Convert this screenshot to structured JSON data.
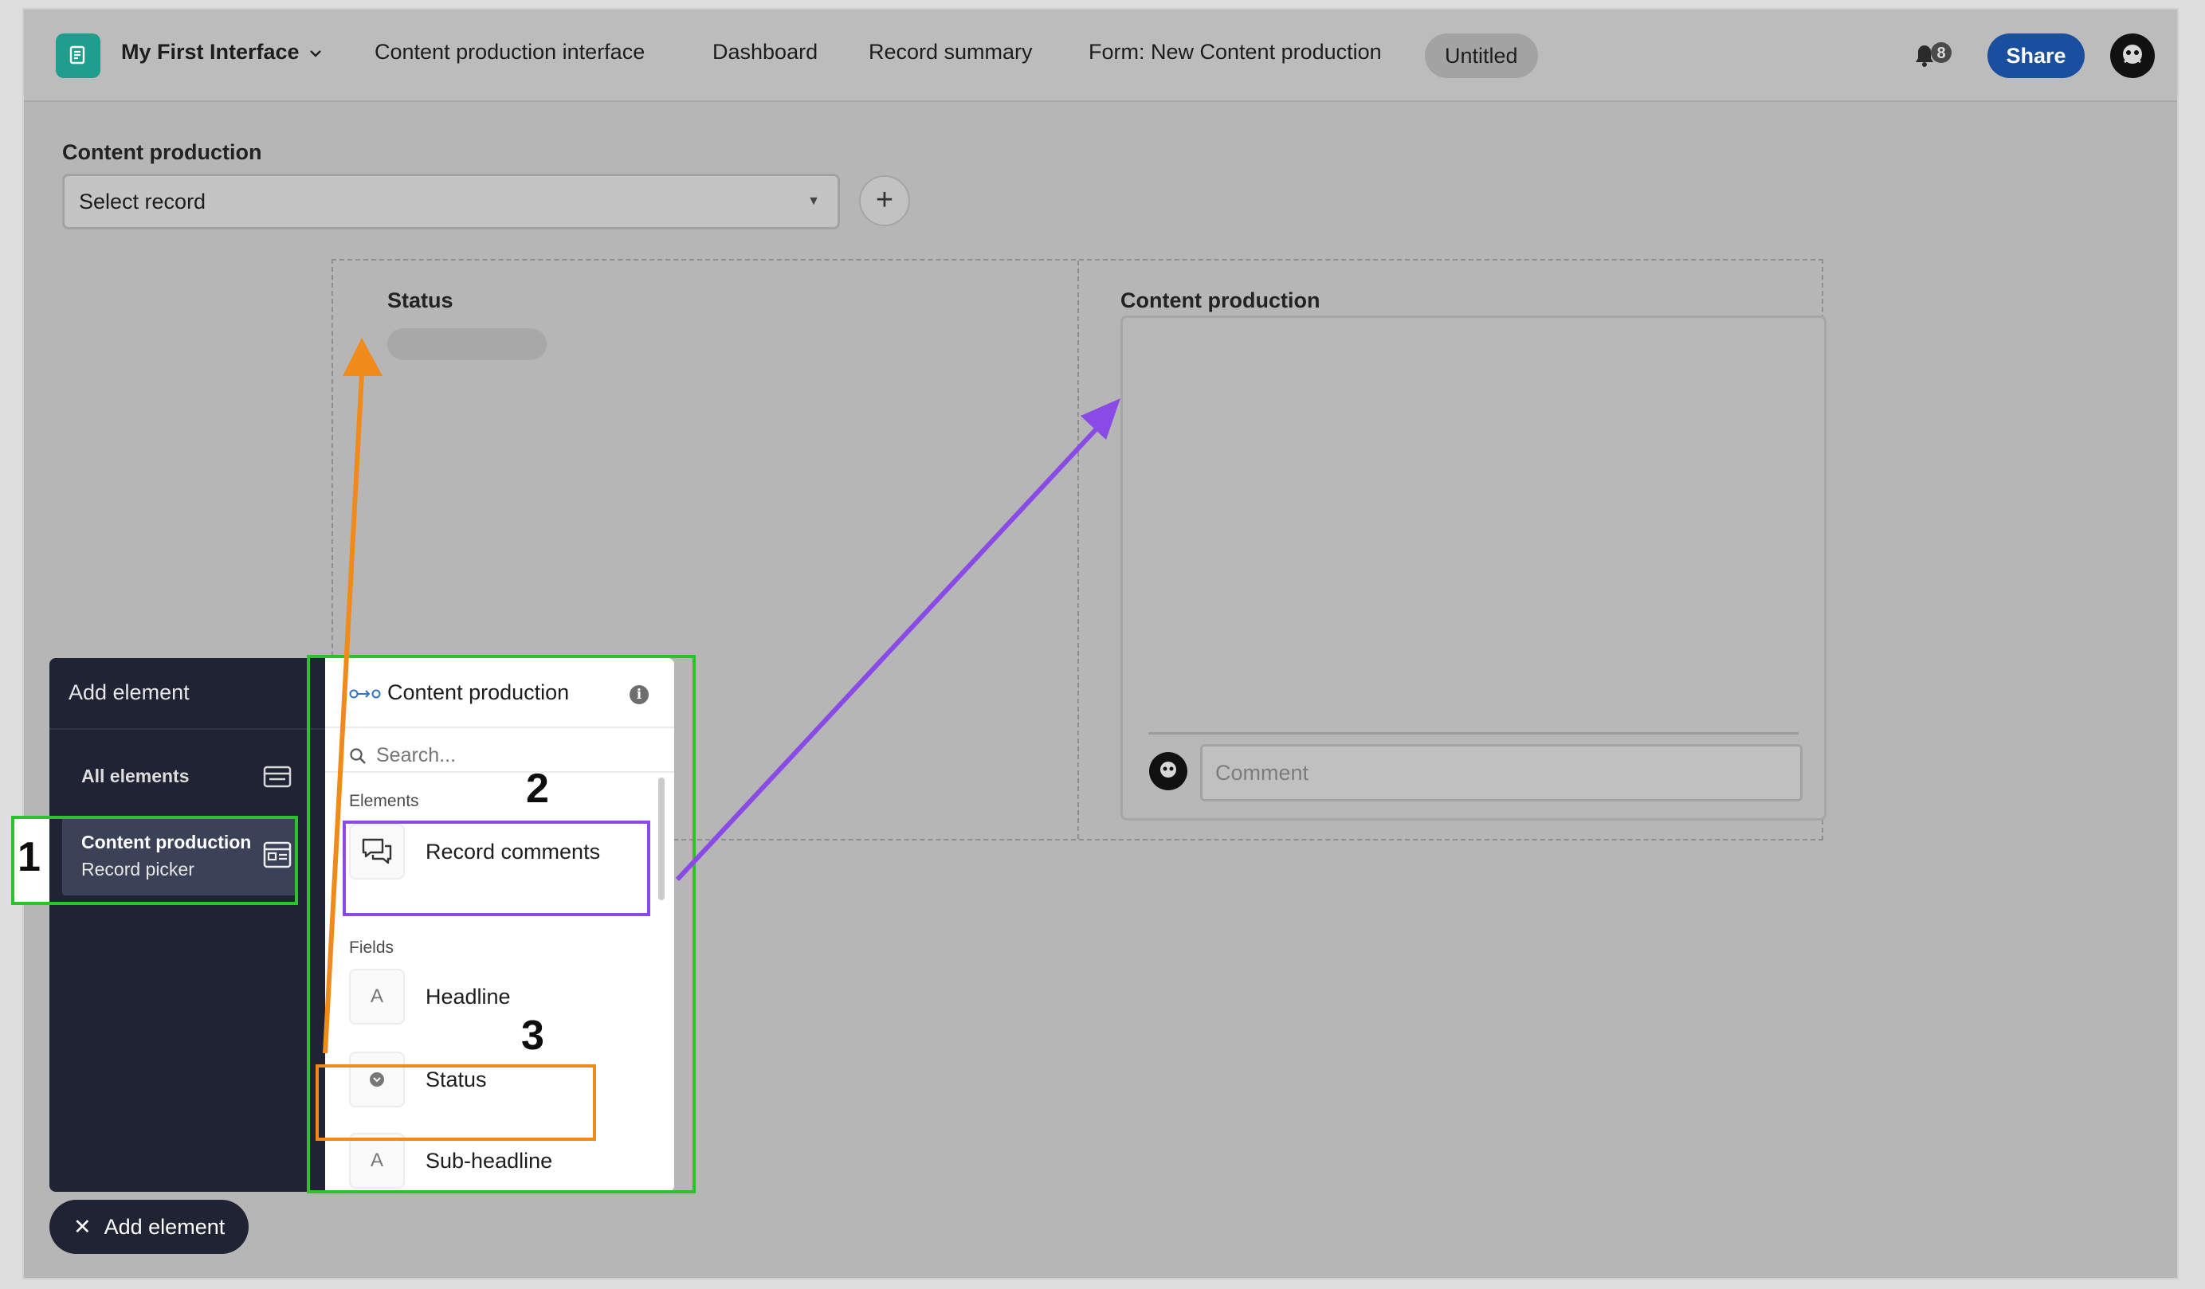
{
  "topbar": {
    "app_name": "My First Interface",
    "nav": [
      "Content production interface",
      "Dashboard",
      "Record summary",
      "Form: New Content production"
    ],
    "active_tab": "Untitled",
    "notification_count": "8",
    "share_label": "Share"
  },
  "record_picker": {
    "label": "Content production",
    "placeholder": "Select record",
    "add_symbol": "+"
  },
  "canvas": {
    "status_title": "Status",
    "comments_title": "Content production",
    "comment_placeholder": "Comment"
  },
  "add_panel": {
    "title": "Add element",
    "all_elements": "All elements",
    "selected_title": "Content production",
    "selected_subtitle": "Record picker",
    "source_title": "Content production",
    "search_placeholder": "Search...",
    "elements_label": "Elements",
    "elements": [
      {
        "label": "Record comments",
        "icon": "comments-icon"
      }
    ],
    "fields_label": "Fields",
    "fields": [
      {
        "label": "Headline",
        "glyph": "A",
        "icon": "text-field-icon"
      },
      {
        "label": "Status",
        "glyph": "",
        "icon": "single-select-icon"
      },
      {
        "label": "Sub-headline",
        "glyph": "A",
        "icon": "text-field-icon"
      }
    ]
  },
  "add_element_button": "Add element",
  "annotations": {
    "one": "1",
    "two": "2",
    "three": "3"
  },
  "colors": {
    "annotation_green": "#2ec12e",
    "annotation_purple": "#8a4ae6",
    "annotation_orange": "#f08a1a",
    "share_blue": "#1a4fa0",
    "panel_dark": "#1f2334"
  }
}
